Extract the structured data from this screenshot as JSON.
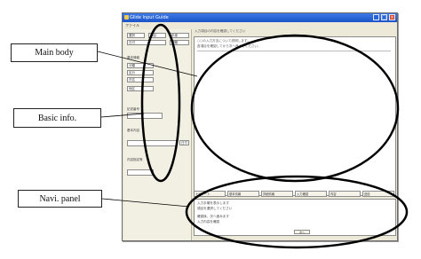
{
  "callouts": {
    "main_body": "Main body",
    "basic_info": "Basic info.",
    "navi_panel": "Navi. panel"
  },
  "window": {
    "title": "Glide Input Guide",
    "menu": "ファイル",
    "left_panel": {
      "selects": [
        "選択",
        "項目",
        "年度",
        "日付",
        "種類",
        "分類",
        "区分"
      ],
      "labels": [
        "基本情報",
        "記述番号",
        "基本内容",
        "内容指定等"
      ],
      "fields": [
        "氏名",
        "地区",
        "日付"
      ]
    },
    "doc_header": "入力項目の内容を確認してください",
    "doc_lines": [
      "○○の入力方法について説明します。",
      "各項目を確認してから次へ進んでください。"
    ],
    "tabs": [
      "ナビゲート",
      "基本情報",
      "詳細情報",
      "入力確認",
      "内容",
      "送信"
    ],
    "navi_lines": [
      "入力手順を表示します",
      "項目を選択してください",
      "確認後、次へ進みます",
      "入力内容を確認"
    ],
    "navi_button": "次へ"
  },
  "colors": {
    "annotation_stroke": "#000000",
    "titlebar": "#2a62d6",
    "window_bg": "#ece9d8"
  }
}
